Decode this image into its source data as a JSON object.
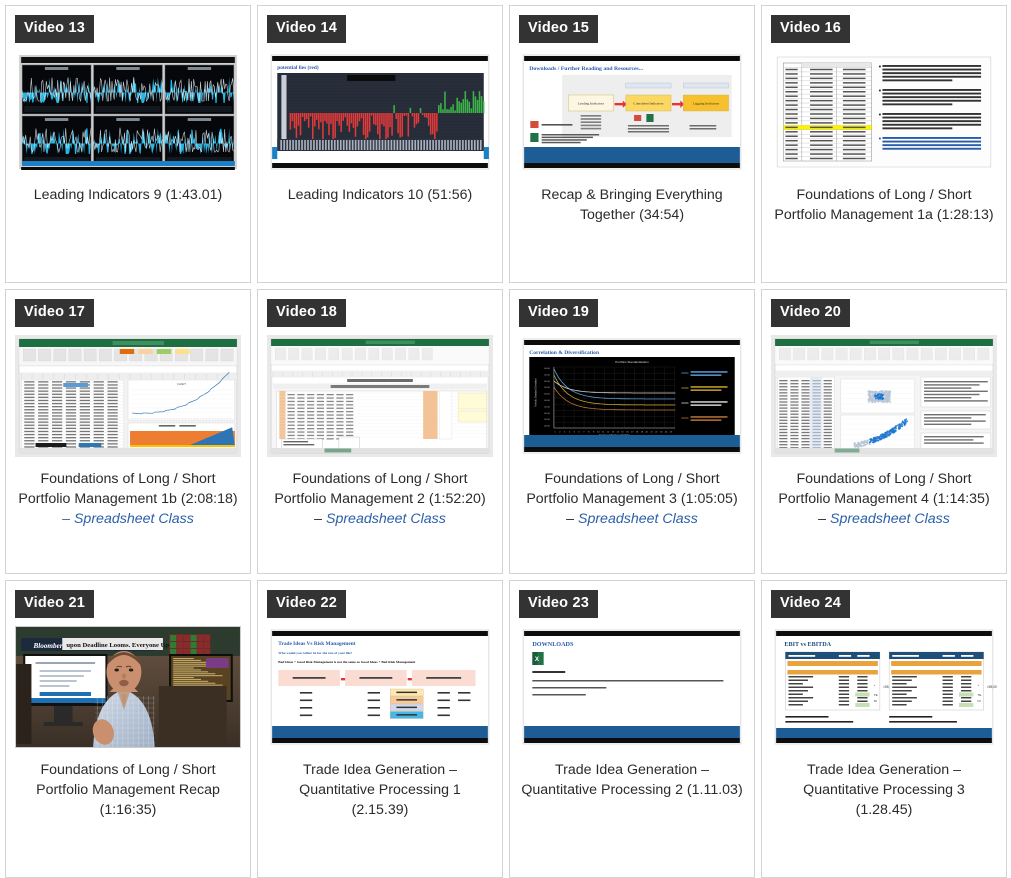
{
  "page": {
    "background_color": "#ffffff",
    "card_border_color": "#d3d3d3",
    "badge_bg_color": "#333333",
    "badge_text_color": "#ffffff",
    "title_color": "#2b2b2b",
    "suffix_color": "#2b5fa8",
    "columns": 4,
    "rows": 3,
    "total_videos": 12
  },
  "videos": [
    {
      "badge": "Video 13",
      "title": "Leading Indicators 9 (1:43.01)",
      "suffix": "",
      "thumb_kind": "six-panel-chart",
      "thumb_name": "thumbnail-leading-indicators-9"
    },
    {
      "badge": "Video 14",
      "title": "Leading Indicators 10 (51:56)",
      "suffix": "",
      "thumb_kind": "redgreen-bars",
      "thumb_caption": "potential lies (red)",
      "thumb_name": "thumbnail-leading-indicators-10"
    },
    {
      "badge": "Video 15",
      "title": "Recap & Bringing Everything Together (34:54)",
      "suffix": "",
      "thumb_kind": "slide-flow",
      "thumb_caption": "Downloads / Further Reading and Resources...",
      "thumb_boxes": [
        "Leading Indicators",
        "Coincident Indicators",
        "Lagging Indicators"
      ],
      "thumb_name": "thumbnail-recap-bringing-everything-together"
    },
    {
      "badge": "Video 16",
      "title": "Foundations of Long / Short Portfolio Management 1a (1:28:13)",
      "suffix": "",
      "thumb_kind": "table-bullets",
      "thumb_name": "thumbnail-foundations-1a"
    },
    {
      "badge": "Video 17",
      "title": "Foundations of Long / Short Portfolio Management 1b (2:08:18)",
      "suffix": "– Spreadsheet Class",
      "thumb_kind": "excel-charts",
      "thumb_name": "thumbnail-foundations-1b"
    },
    {
      "badge": "Video 18",
      "title": "Foundations of Long / Short Portfolio Management 2 (1:52:20) –",
      "suffix": "Spreadsheet Class",
      "thumb_kind": "excel-blank",
      "thumb_name": "thumbnail-foundations-2"
    },
    {
      "badge": "Video 19",
      "title": "Foundations of Long / Short Portfolio Management 3 (1:05:05) –",
      "suffix": "Spreadsheet Class",
      "thumb_kind": "correlation-curve",
      "thumb_caption": "Correlation & Diversification",
      "thumb_name": "thumbnail-foundations-3"
    },
    {
      "badge": "Video 20",
      "title": "Foundations of Long / Short Portfolio Management 4 (1:14:35) –",
      "suffix": "Spreadsheet Class",
      "thumb_kind": "excel-scatter",
      "thumb_name": "thumbnail-foundations-4"
    },
    {
      "badge": "Video 21",
      "title": "Foundations of Long / Short Portfolio Management Recap (1:16:35)",
      "suffix": "",
      "thumb_kind": "presenter-photo",
      "thumb_name": "thumbnail-foundations-recap"
    },
    {
      "badge": "Video 22",
      "title": "Trade Idea Generation – Quantitative Processing 1 (2.15.39)",
      "suffix": "",
      "thumb_kind": "risk-table",
      "thumb_caption": "Trade Ideas Vs Risk Management",
      "thumb_name": "thumbnail-trade-idea-generation-1"
    },
    {
      "badge": "Video 23",
      "title": "Trade Idea Generation – Quantitative Processing 2 (1.11.03)",
      "suffix": "",
      "thumb_kind": "downloads-slide",
      "thumb_caption": "DOWNLOADS",
      "thumb_name": "thumbnail-trade-idea-generation-2"
    },
    {
      "badge": "Video 24",
      "title": "Trade Idea Generation – Quantitative Processing 3 (1.28.45)",
      "suffix": "",
      "thumb_kind": "ebit-slide",
      "thumb_caption": "EBIT vs EBITDA",
      "thumb_name": "thumbnail-trade-idea-generation-3"
    }
  ]
}
